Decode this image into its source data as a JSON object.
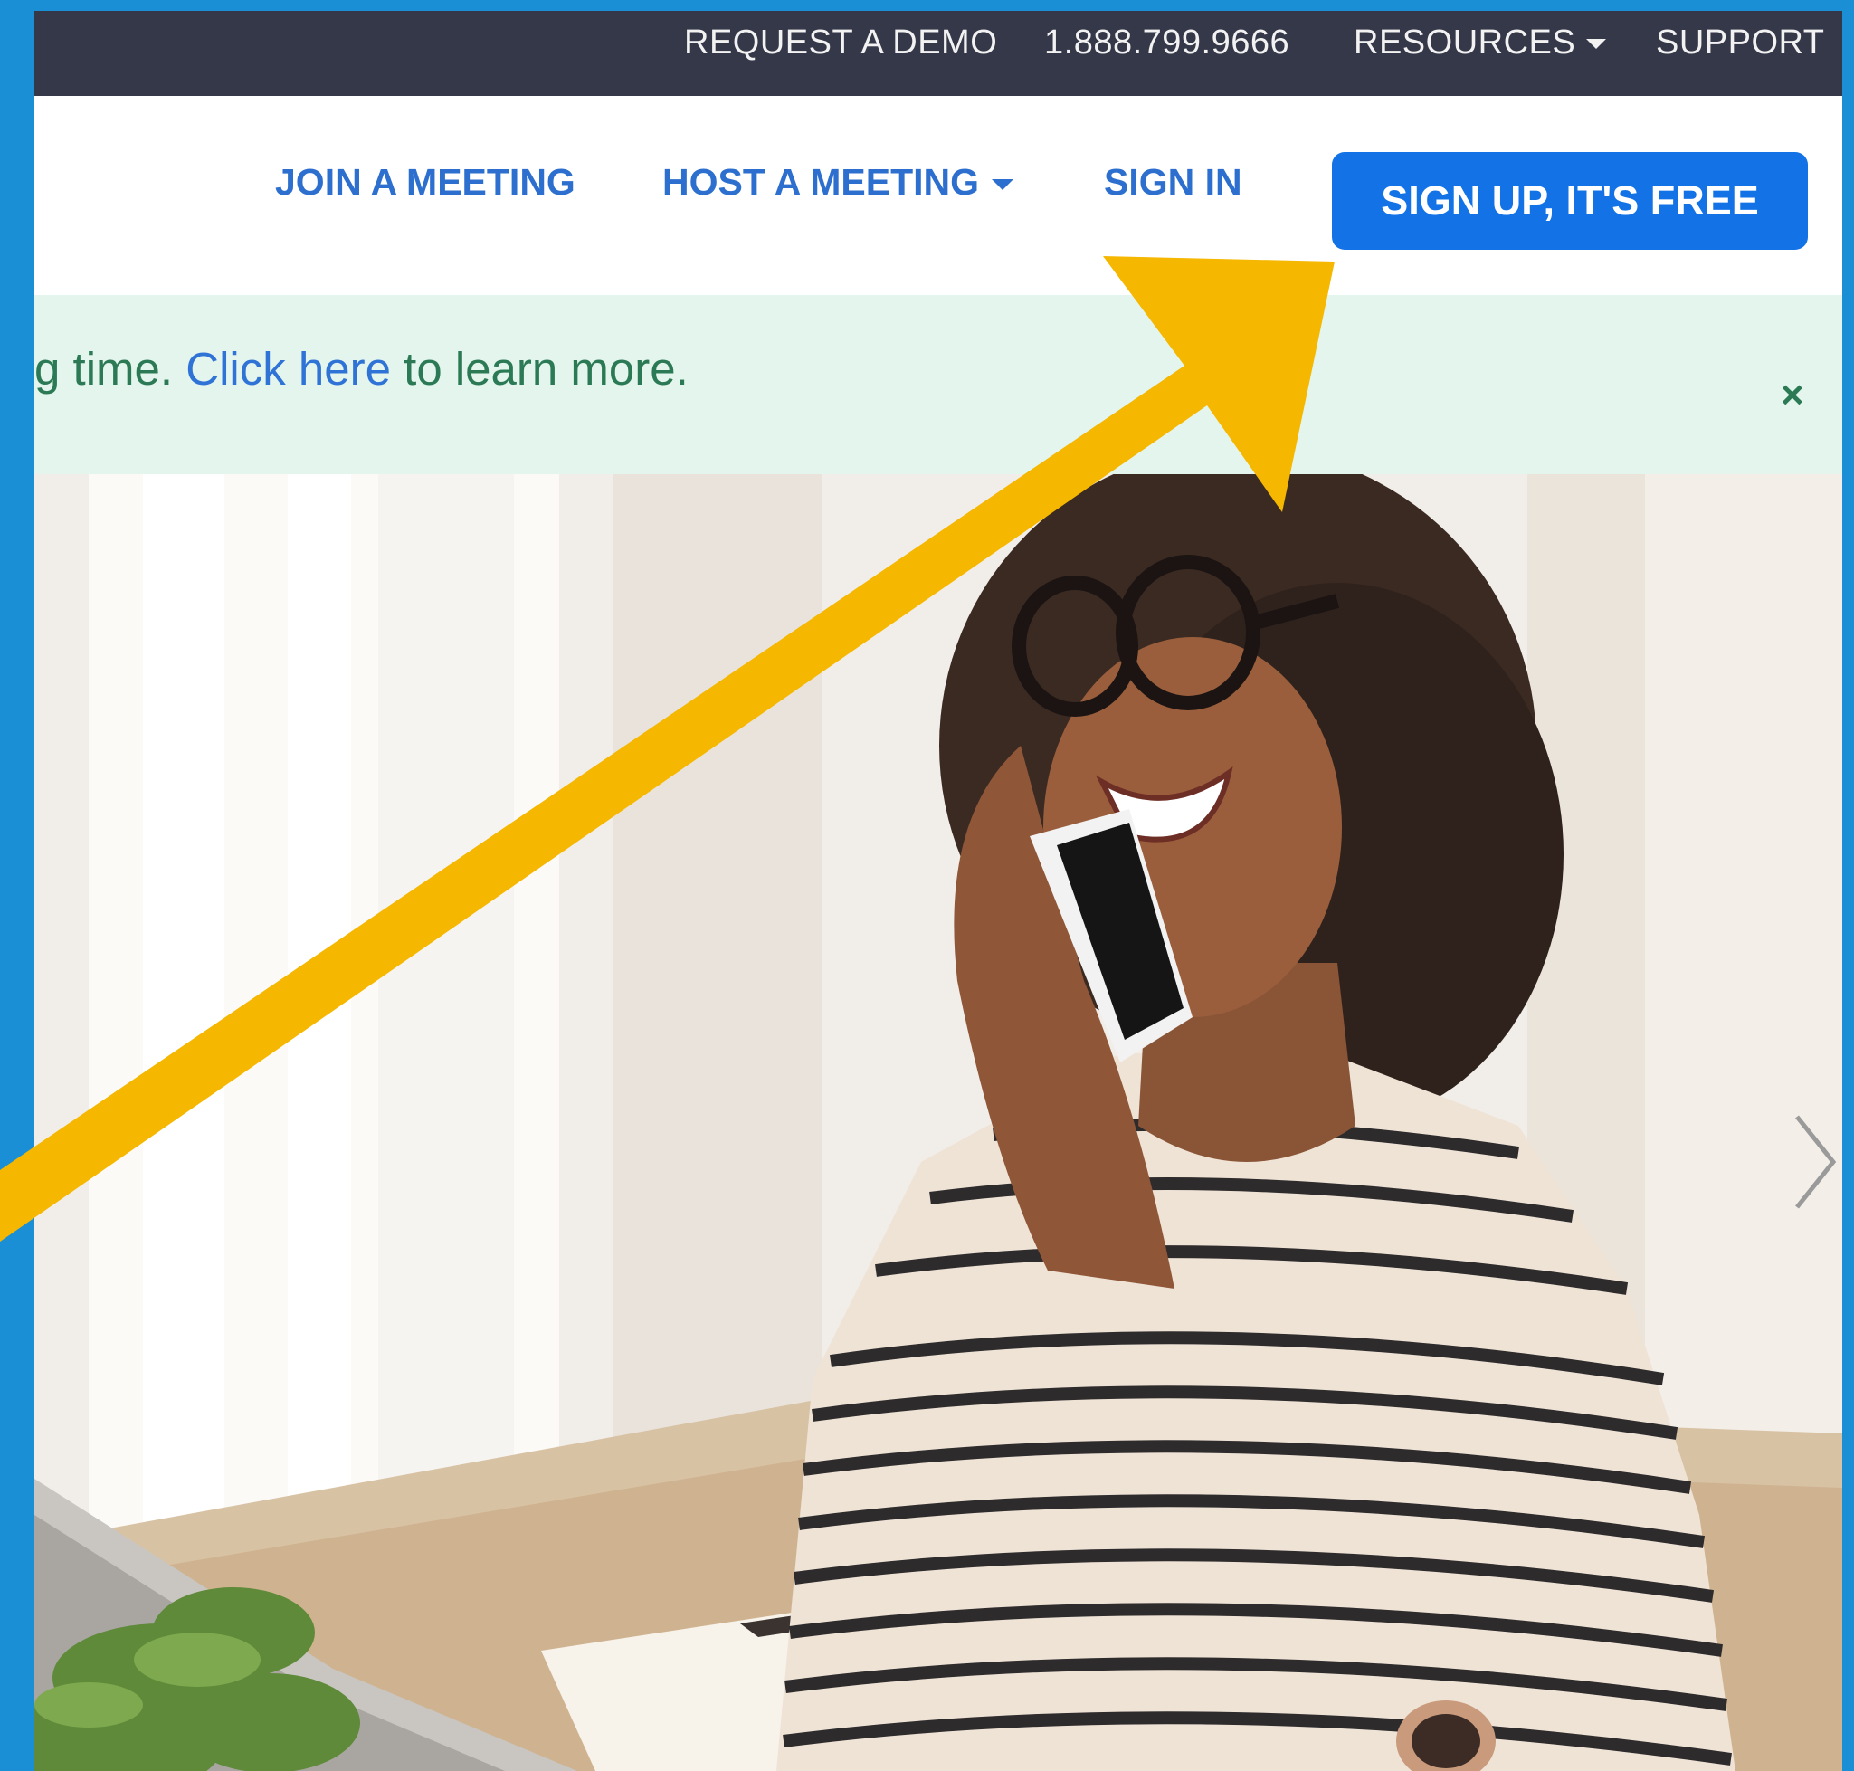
{
  "topbar": {
    "request_demo": "REQUEST A DEMO",
    "phone": "1.888.799.9666",
    "resources": "RESOURCES",
    "support": "SUPPORT"
  },
  "nav": {
    "join": "JOIN A MEETING",
    "host": "HOST A MEETING",
    "signin": "SIGN IN",
    "signup": "SIGN UP, IT'S FREE"
  },
  "banner": {
    "text_before": "g time. ",
    "link": "Click here",
    "text_after": " to learn more.",
    "close": "×"
  },
  "colors": {
    "frame_border": "#1b8fd6",
    "topbar_bg": "#353849",
    "nav_link": "#2d6fce",
    "signup_bg": "#1373e6",
    "banner_bg": "#e3f5ec",
    "annotation_arrow": "#f5b700"
  },
  "icons": {
    "resources_caret": "caret-down-icon",
    "host_caret": "caret-down-icon",
    "banner_close": "close-icon",
    "carousel_next": "chevron-right-icon",
    "annotation": "arrow-icon"
  }
}
